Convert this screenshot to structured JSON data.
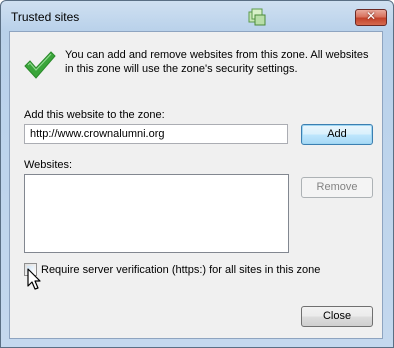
{
  "window": {
    "title": "Trusted sites",
    "close_glyph": "✕",
    "app_icon": "zone-icon",
    "close_icon": "close-icon"
  },
  "info": {
    "icon": "checkmark-icon",
    "text": "You can add and remove websites from this zone. All websites in this zone will use the zone's security settings."
  },
  "add_site": {
    "label": "Add this website to the zone:",
    "value": "http://www.crownalumni.org",
    "button": "Add"
  },
  "websites": {
    "label": "Websites:",
    "items": [],
    "remove_button": "Remove"
  },
  "https_option": {
    "label": "Require server verification (https:) for all sites in this zone",
    "checked": false
  },
  "footer": {
    "close_button": "Close"
  },
  "colors": {
    "check_green": "#3aa53a",
    "client_bg": "#f0f0f0",
    "title_bg": "#b9d1ea"
  }
}
